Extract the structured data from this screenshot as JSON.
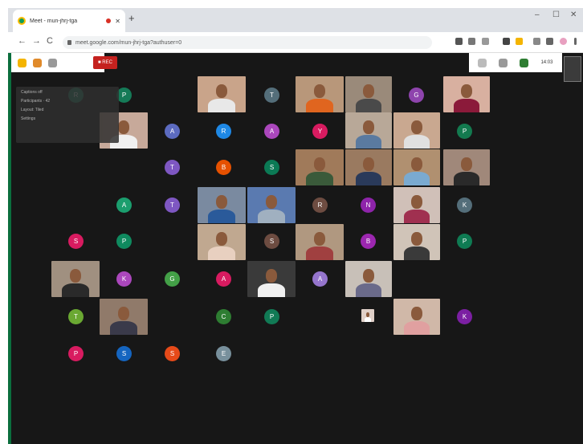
{
  "browser": {
    "tab_title": "Meet - mun-jhrj-tga",
    "url": "meet.google.com/mun-jhrj-tga?authuser=0",
    "window_controls": {
      "minimize": "–",
      "maximize": "☐",
      "close": "✕"
    },
    "nav": {
      "back": "←",
      "forward": "→",
      "reload": "C"
    }
  },
  "meet": {
    "stop_label": "■ REC",
    "time": "14:03",
    "popup_lines": [
      "Captions off",
      "Participants · 42",
      "Layout: Tiled",
      "Settings"
    ]
  },
  "avatars": [
    {
      "letter": "R",
      "color": "#1f8a68"
    },
    {
      "letter": "P",
      "color": "#157a57"
    },
    {
      "letter": "T",
      "color": "#546e7a"
    },
    {
      "letter": "G",
      "color": "#8e44ad"
    },
    {
      "letter": "A",
      "color": "#5c6bc0"
    },
    {
      "letter": "R",
      "color": "#1e88e5"
    },
    {
      "letter": "A",
      "color": "#ab47bc"
    },
    {
      "letter": "Y",
      "color": "#d81b60"
    },
    {
      "letter": "P",
      "color": "#137a4f"
    },
    {
      "letter": "T",
      "color": "#7e57c2"
    },
    {
      "letter": "B",
      "color": "#e65100"
    },
    {
      "letter": "S",
      "color": "#0b7a55"
    },
    {
      "letter": "A",
      "color": "#1b9e6e"
    },
    {
      "letter": "T",
      "color": "#7e57c2"
    },
    {
      "letter": "R",
      "color": "#6d4c41"
    },
    {
      "letter": "N",
      "color": "#8e24aa"
    },
    {
      "letter": "K",
      "color": "#546e7a"
    },
    {
      "letter": "S",
      "color": "#d81b60"
    },
    {
      "letter": "P",
      "color": "#0f8a5f"
    },
    {
      "letter": "S",
      "color": "#6d4c41"
    },
    {
      "letter": "B",
      "color": "#9c27b0"
    },
    {
      "letter": "P",
      "color": "#0f7b53"
    },
    {
      "letter": "K",
      "color": "#ab47bc"
    },
    {
      "letter": "G",
      "color": "#43a047"
    },
    {
      "letter": "A",
      "color": "#d81b60"
    },
    {
      "letter": "A",
      "color": "#9575cd"
    },
    {
      "letter": "T",
      "color": "#6aa832"
    },
    {
      "letter": "C",
      "color": "#2e7d32"
    },
    {
      "letter": "P",
      "color": "#117a55"
    },
    {
      "letter": "K",
      "color": "#7b1fa2"
    },
    {
      "letter": "P",
      "color": "#d81b60"
    },
    {
      "letter": "S",
      "color": "#1565c0"
    },
    {
      "letter": "S",
      "color": "#e64a19"
    },
    {
      "letter": "E",
      "color": "#78909c"
    }
  ],
  "videos": [
    {
      "bg": "#c9a48a",
      "shirt": "#e8e8e8"
    },
    {
      "bg": "#b8977a",
      "shirt": "#e0651f"
    },
    {
      "bg": "#9a8a7a",
      "shirt": "#4a4a4a"
    },
    {
      "bg": "#d8b0a0",
      "shirt": "#8b1a3a"
    },
    {
      "bg": "#c7a99a",
      "shirt": "#f0f0f0"
    },
    {
      "bg": "#b8a898",
      "shirt": "#5a7aa0"
    },
    {
      "bg": "#c9a890",
      "shirt": "#e0e0e0"
    },
    {
      "bg": "#a07a5a",
      "shirt": "#3a5a3a"
    },
    {
      "bg": "#9a7a60",
      "shirt": "#2a3a5a"
    },
    {
      "bg": "#b09070",
      "shirt": "#7aaad0"
    },
    {
      "bg": "#a0887a",
      "shirt": "#2a2a2a"
    },
    {
      "bg": "#7a8aa0",
      "shirt": "#2a5a9a"
    },
    {
      "bg": "#5a7ab0",
      "shirt": "#a0b0c0"
    },
    {
      "bg": "#d0c0b8",
      "shirt": "#a03050"
    },
    {
      "bg": "#c0a890",
      "shirt": "#e8d0c0"
    },
    {
      "bg": "#b09880",
      "shirt": "#a04040"
    },
    {
      "bg": "#d0c4b8",
      "shirt": "#3a3a3a"
    },
    {
      "bg": "#a09080",
      "shirt": "#2a2a2a"
    },
    {
      "bg": "#3a3a3a",
      "shirt": "#f0f0f0"
    },
    {
      "bg": "#c8c0b8",
      "shirt": "#6a6a8a"
    },
    {
      "bg": "#907a6a",
      "shirt": "#3a3a4a"
    },
    {
      "bg": "#d0b8a8",
      "shirt": "#e0a0a0"
    },
    {
      "bg": "#e0d0c8",
      "shirt": "#ffffff"
    }
  ]
}
